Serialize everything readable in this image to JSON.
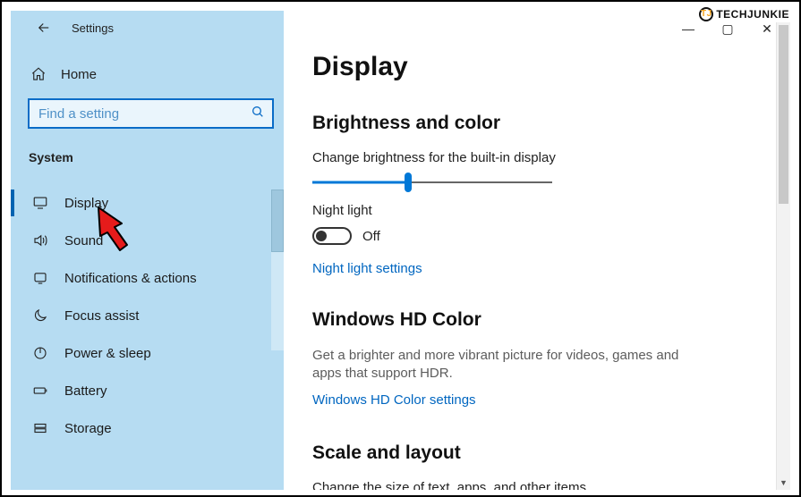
{
  "watermark": {
    "text": "TECHJUNKIE",
    "badge": "TJ"
  },
  "window_controls": {
    "min": "—",
    "max": "▢",
    "close": "✕"
  },
  "header": {
    "back_aria": "Back",
    "title": "Settings"
  },
  "home": {
    "label": "Home"
  },
  "search": {
    "placeholder": "Find a setting",
    "value": ""
  },
  "category": "System",
  "nav": [
    {
      "id": "display",
      "label": "Display",
      "selected": true
    },
    {
      "id": "sound",
      "label": "Sound",
      "selected": false
    },
    {
      "id": "notifications",
      "label": "Notifications & actions",
      "selected": false
    },
    {
      "id": "focus-assist",
      "label": "Focus assist",
      "selected": false
    },
    {
      "id": "power-sleep",
      "label": "Power & sleep",
      "selected": false
    },
    {
      "id": "battery",
      "label": "Battery",
      "selected": false
    },
    {
      "id": "storage",
      "label": "Storage",
      "selected": false
    }
  ],
  "page": {
    "title": "Display",
    "brightness": {
      "section_title": "Brightness and color",
      "slider_label": "Change brightness for the built-in display",
      "slider_value_pct": 40,
      "night_light_label": "Night light",
      "night_light_state": "Off",
      "night_light_link": "Night light settings"
    },
    "hdcolor": {
      "section_title": "Windows HD Color",
      "desc": "Get a brighter and more vibrant picture for videos, games and apps that support HDR.",
      "link": "Windows HD Color settings"
    },
    "scale": {
      "section_title": "Scale and layout",
      "desc": "Change the size of text, apps, and other items"
    }
  },
  "colors": {
    "sidebar_bg": "#b6dcf2",
    "accent": "#0078d7",
    "link": "#0066c0"
  }
}
